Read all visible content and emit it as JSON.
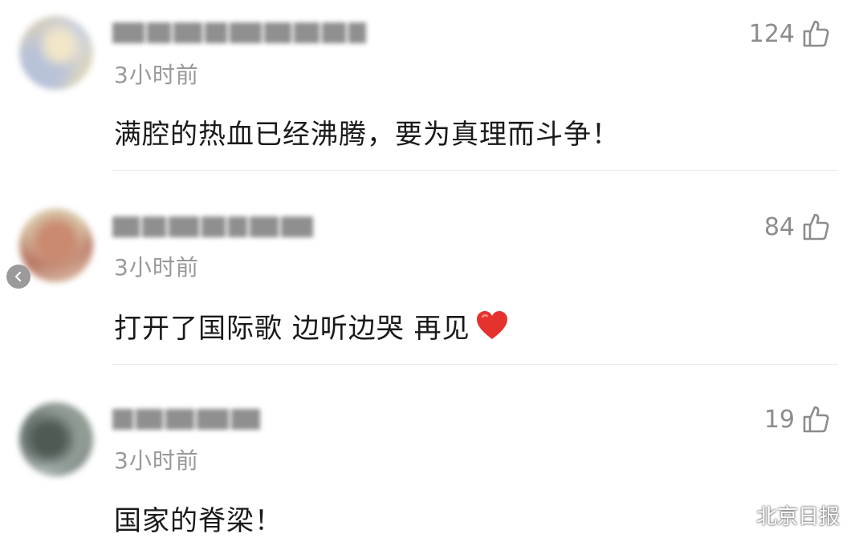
{
  "comments": [
    {
      "username": "",
      "time": "3小时前",
      "text": "满腔的热血已经沸腾，要为真理而斗争！",
      "likes": "124",
      "emoji": ""
    },
    {
      "username": "",
      "time": "3小时前",
      "text": "打开了国际歌 边听边哭 再见",
      "likes": "84",
      "emoji": "red-heart"
    },
    {
      "username": "",
      "time": "3小时前",
      "text": "国家的脊梁！",
      "likes": "19",
      "emoji": ""
    }
  ],
  "watermark": {
    "text": "北京日报",
    "icon": "wechat-icon"
  },
  "colors": {
    "time": "#999999",
    "likes": "#8c8c8c",
    "text": "#1a1a1a",
    "heart": "#e5322d"
  }
}
